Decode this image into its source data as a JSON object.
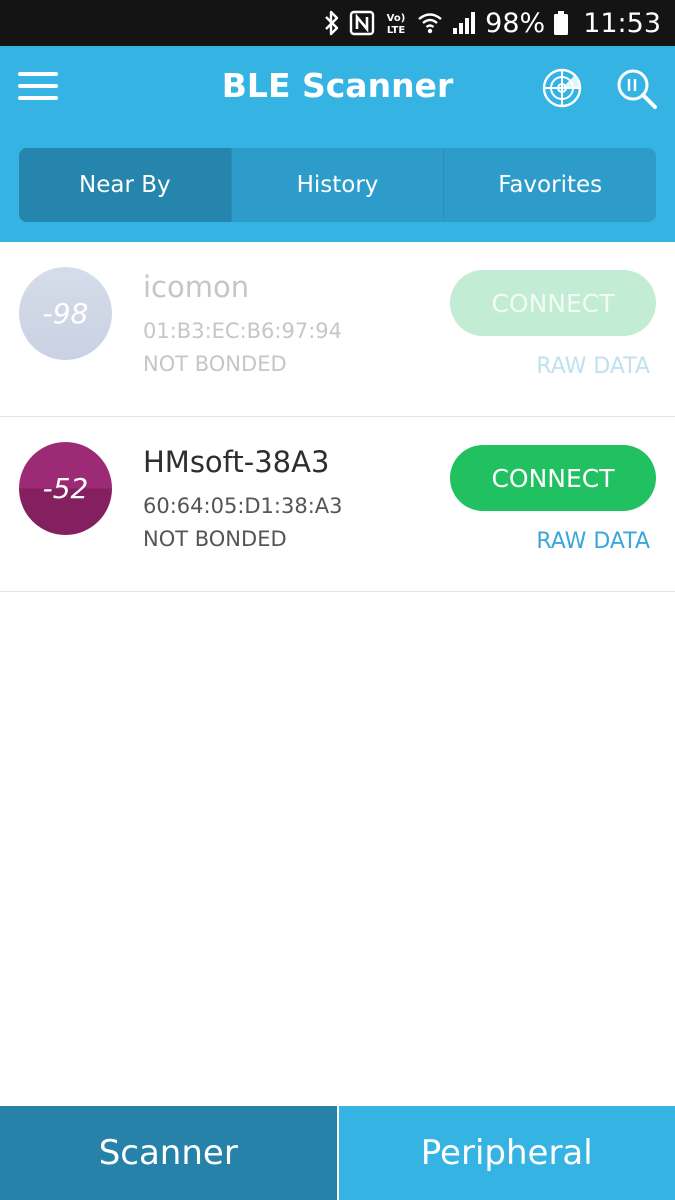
{
  "status_bar": {
    "battery": "98%",
    "time": "11:53",
    "icons": [
      "bluetooth-icon",
      "nfc-icon",
      "volte-icon",
      "wifi-icon",
      "signal-icon",
      "battery-icon"
    ]
  },
  "app_bar": {
    "title": "BLE Scanner",
    "icons": [
      "menu-icon",
      "radar-icon",
      "search-icon"
    ],
    "background": "#35b4e4"
  },
  "tabs": [
    {
      "label": "Near By",
      "active": true
    },
    {
      "label": "History",
      "active": false
    },
    {
      "label": "Favorites",
      "active": false
    }
  ],
  "devices": [
    {
      "rssi": "-98",
      "name": "icomon",
      "mac": "01:B3:EC:B6:97:94",
      "bond": "NOT BONDED",
      "connect_label": "CONNECT",
      "raw_label": "RAW DATA"
    },
    {
      "rssi": "-52",
      "name": "HMsoft-38A3",
      "mac": "60:64:05:D1:38:A3",
      "bond": "NOT BONDED",
      "connect_label": "CONNECT",
      "raw_label": "RAW DATA"
    }
  ],
  "bottom_nav": {
    "scanner": "Scanner",
    "peripheral": "Peripheral"
  },
  "colors": {
    "accent": "#35b4e4",
    "connect_green": "#21c162",
    "rssi_strong": "#9d2a74",
    "link_blue": "#3aa6dc"
  }
}
